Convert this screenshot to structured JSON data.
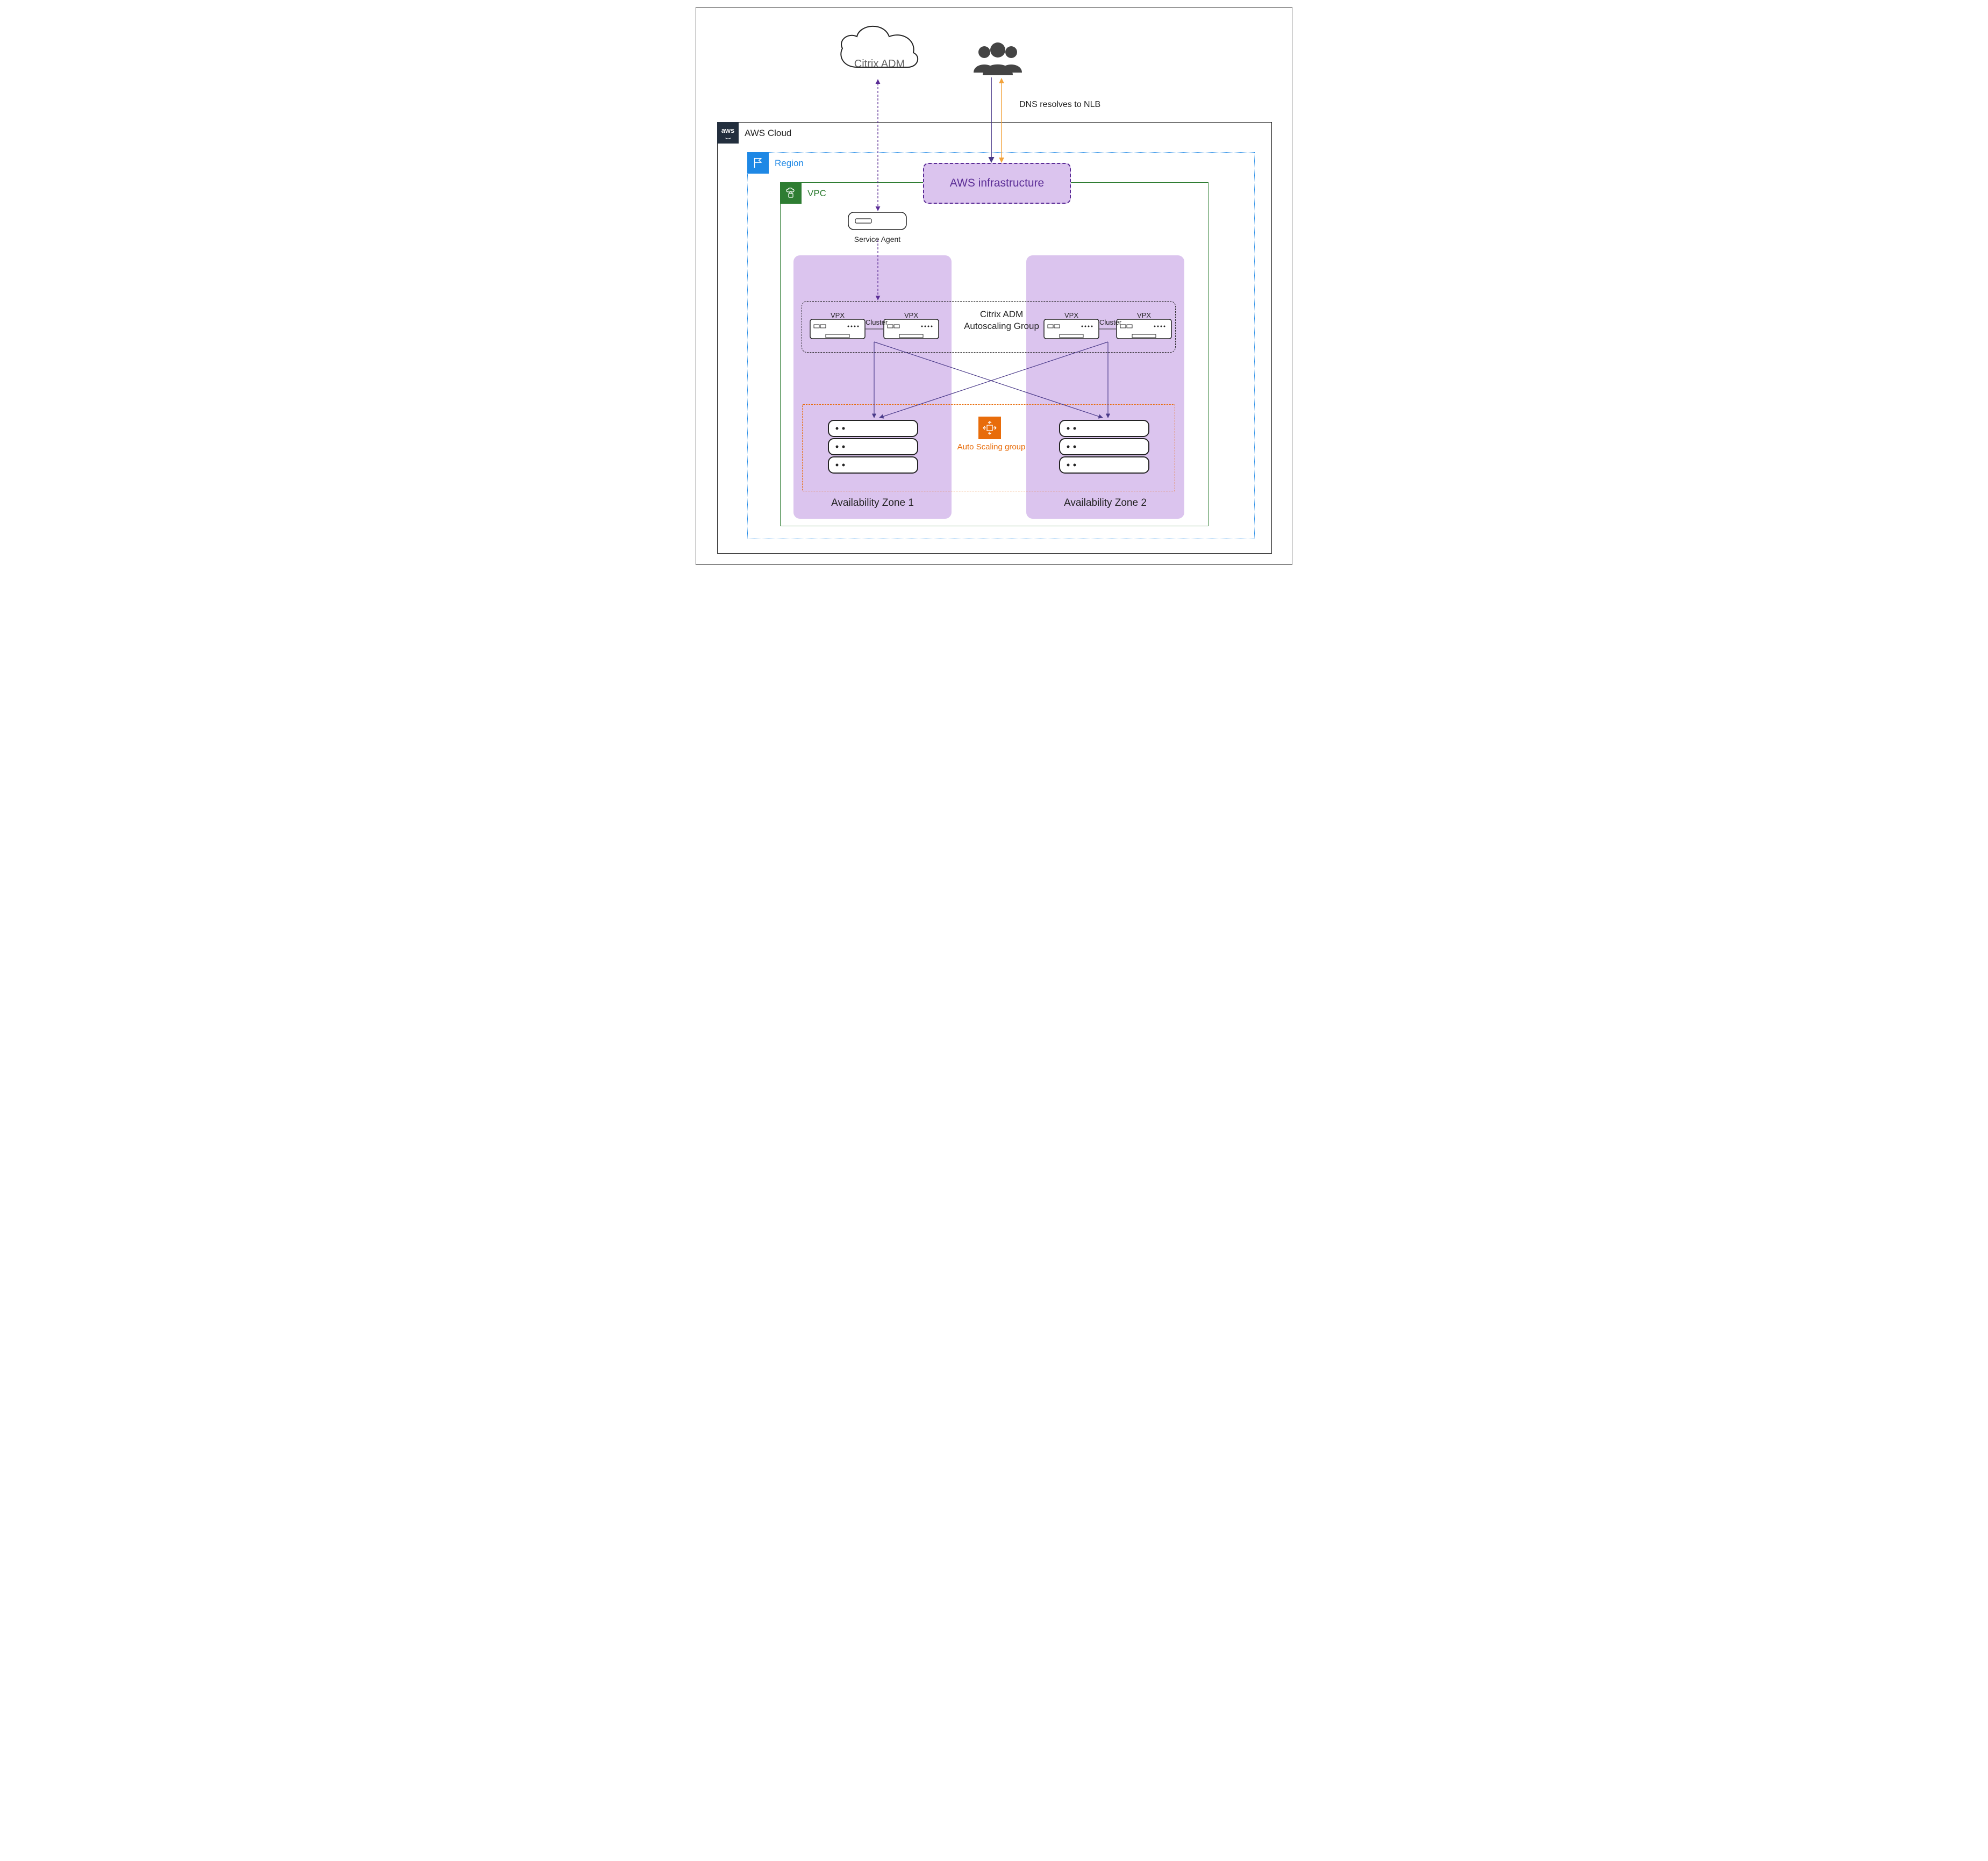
{
  "cloud_label": "Citrix ADM",
  "dns_label": "DNS resolves to NLB",
  "aws_cloud_label": "AWS Cloud",
  "region_label": "Region",
  "vpc_label": "VPC",
  "aws_infra_label": "AWS infrastructure",
  "service_agent_label": "Service Agent",
  "adm_asg_label": "Citrix ADM Autoscaling Group",
  "vpx_label": "VPX",
  "cluster_label": "Cluster",
  "asg_label": "Auto Scaling group",
  "az1_label": "Availability Zone 1",
  "az2_label": "Availability Zone 2",
  "colors": {
    "purple_fill": "#dbc4ee",
    "purple_border": "#5b2d96",
    "green": "#2e7d32",
    "blue": "#1e88e5",
    "orange": "#e86c0a",
    "aws_dark": "#232f3e"
  }
}
